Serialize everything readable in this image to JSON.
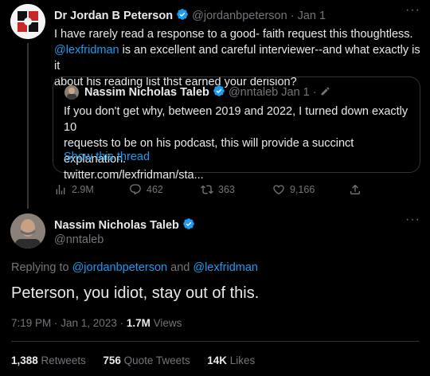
{
  "first_tweet": {
    "display_name": "Dr Jordan B Peterson",
    "handle": "@jordanbpeterson",
    "separator": "·",
    "date": "Jan 1",
    "text_line1": "I have rarely read a response to a good- faith request this thoughtless.",
    "mention": "@lexfridman",
    "text_line2_rest": " is an excellent and careful interviewer--and what exactly is it",
    "text_line3": "about his reading list thst earned your derision?",
    "quote": {
      "display_name": "Nassim Nicholas Taleb",
      "handle": "@nntaleb",
      "date": "Jan 1 ·",
      "text_line1": "If you don't get why, between 2019 and 2022, I turned down exactly 10",
      "text_line2": "requests to be on his podcast, this will provide a succinct explanation.",
      "text_line3": "twitter.com/lexfridman/sta...",
      "show_thread": "Show this thread"
    },
    "stats": {
      "views": "2.9M",
      "replies": "462",
      "retweets": "363",
      "likes": "9,166"
    }
  },
  "main_tweet": {
    "display_name": "Nassim Nicholas Taleb",
    "handle": "@nntaleb",
    "replying_prefix": "Replying to ",
    "replying_user1": "@jordanbpeterson",
    "replying_and": " and ",
    "replying_user2": "@lexfridman",
    "text": "Peterson, you idiot, stay out of this.",
    "time": "7:19 PM · Jan 1, 2023 · ",
    "views_count": "1.7M",
    "views_label": " Views",
    "retweets_count": "1,388",
    "retweets_label": " Retweets",
    "quotes_count": "756",
    "quotes_label": " Quote Tweets",
    "likes_count": "14K",
    "likes_label": " Likes"
  },
  "colors": {
    "background": "#000000",
    "text": "#e7e9ea",
    "muted": "#71767b",
    "accent": "#1d9bf0",
    "border": "#2f3336"
  }
}
